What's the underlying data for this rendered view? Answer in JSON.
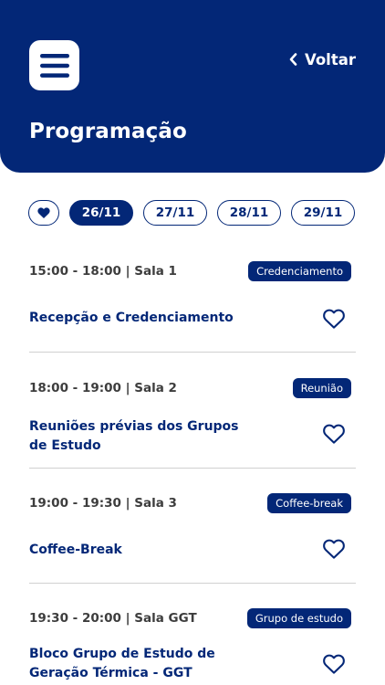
{
  "header": {
    "title": "Programação",
    "back_label": "Voltar"
  },
  "filters": {
    "dates": [
      "26/11",
      "27/11",
      "28/11",
      "29/11"
    ],
    "selected": "26/11"
  },
  "events": [
    {
      "time": "15:00 - 18:00 | Sala 1",
      "tag": "Credenciamento",
      "title": "Recepção e Credenciamento"
    },
    {
      "time": "18:00 - 19:00 | Sala 2",
      "tag": "Reunião",
      "title": "Reuniões prévias dos Grupos de Estudo"
    },
    {
      "time": "19:00 - 19:30 | Sala 3",
      "tag": "Coffee-break",
      "title": "Coffee-Break"
    },
    {
      "time": "19:30 - 20:00 | Sala GGT",
      "tag": "Grupo de estudo",
      "title": "Bloco Grupo de Estudo de Geração Térmica - GGT"
    }
  ],
  "colors": {
    "primary": "#032777",
    "divider": "#d0d0d0",
    "time_text": "#3d3d3d"
  },
  "icons": {
    "menu": "menu-icon",
    "back": "chevron-left-icon",
    "favorite_filter": "heart-filled-icon",
    "favorite": "heart-outline-icon"
  }
}
